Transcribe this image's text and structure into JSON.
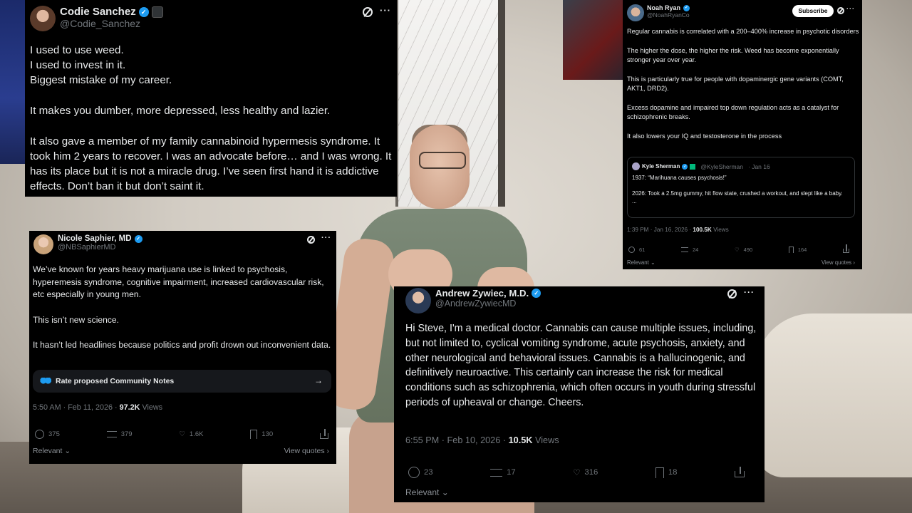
{
  "tweets": [
    {
      "name": "Codie Sanchez",
      "handle": "@Codie_Sanchez",
      "paragraphs": [
        "I used to use weed.",
        "I used to invest in it.",
        "Biggest mistake of my career.",
        "It makes you dumber, more depressed, less healthy and lazier.",
        "It also gave a member of my family cannabinoid hypermesis syndrome. It took him 2 years to recover. I was an advocate before… and I was wrong. It has its place but it is not a miracle drug. I’ve seen first hand it is addictive effects. Don’t ban it but don’t saint it."
      ]
    },
    {
      "name": "Noah Ryan",
      "handle": "@NoahRyanCo",
      "subscribe_label": "Subscribe",
      "paragraphs": [
        "Regular cannabis is correlated with a 200–400% increase in psychotic disorders",
        "The higher the dose, the higher the risk. Weed has become exponentially stronger year over year.",
        "This is particularly true for people with dopaminergic gene variants (COMT, AKT1, DRD2).",
        "Excess dopamine and impaired top down regulation acts as a catalyst for schizophrenic breaks.",
        "It also lowers your IQ and testosterone in the process"
      ],
      "quote": {
        "name": "Kyle Sherman",
        "handle": "@KyleSherman",
        "date": "· Jan 16",
        "line1": "1937: “Marihuana causes psychosis!”",
        "line2": "2026: Took a 2.5mg gummy, hit flow state, crushed a workout, and slept like a baby.",
        "line3": "..."
      },
      "time": "1:39 PM · Jan 16, 2026 · ",
      "views": "100.5K",
      "views_label": " Views",
      "replies": "61",
      "reposts": "24",
      "likes": "490",
      "bookmarks": "164",
      "relevant": "Relevant",
      "view_quotes": "View quotes"
    },
    {
      "name": "Nicole Saphier, MD",
      "handle": "@NBSaphierMD",
      "paragraphs": [
        "We’ve known for years heavy marijuana use is linked to psychosis, hyperemesis syndrome, cognitive impairment, increased cardiovascular risk, etc especially in young men.",
        "This isn’t new science.",
        "It hasn’t led headlines because politics and profit drown out inconvenient data."
      ],
      "notes_label": "Rate proposed Community Notes",
      "time": "5:50 AM · Feb 11, 2026 · ",
      "views": "97.2K",
      "views_label": " Views",
      "replies": "375",
      "reposts": "379",
      "likes": "1.6K",
      "bookmarks": "130",
      "relevant": "Relevant",
      "view_quotes": "View quotes"
    },
    {
      "name": "Andrew Zywiec, M.D.",
      "handle": "@AndrewZywiecMD",
      "text": "Hi Steve, I'm a medical doctor. Cannabis can cause multiple issues, including, but not limited to, cyclical vomiting syndrome, acute psychosis, anxiety, and other neurological and behavioral issues. Cannabis is a hallucinogenic, and definitively neuroactive. This certainly can increase the risk for medical conditions such as schizophrenia, which often occurs in youth during stressful periods of upheaval or change. Cheers.",
      "time": "6:55 PM · Feb 10, 2026 · ",
      "views": "10.5K",
      "views_label": " Views",
      "replies": "23",
      "reposts": "17",
      "likes": "316",
      "bookmarks": "18",
      "relevant": "Relevant"
    }
  ],
  "icons": {
    "verified": "✓",
    "heart": "♡",
    "arrow_right": "→",
    "more": "···",
    "chevron": "⌄",
    "chevron_right": "›"
  },
  "colors": {
    "card_bg": "#000000",
    "text": "#e7e9ea",
    "muted": "#71767b",
    "verified_blue": "#1d9bf0"
  }
}
